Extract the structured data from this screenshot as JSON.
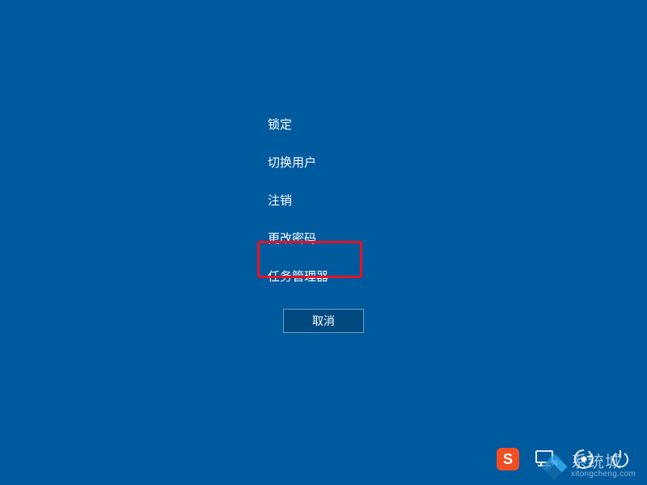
{
  "menu": {
    "items": [
      {
        "label": "锁定"
      },
      {
        "label": "切换用户"
      },
      {
        "label": "注销"
      },
      {
        "label": "更改密码"
      },
      {
        "label": "任务管理器"
      }
    ],
    "highlighted_index": 4
  },
  "cancel": {
    "label": "取消"
  },
  "taskbar": {
    "ime_label": "S"
  },
  "watermark": {
    "title": "系统城",
    "url": "xitongcheng.com"
  }
}
